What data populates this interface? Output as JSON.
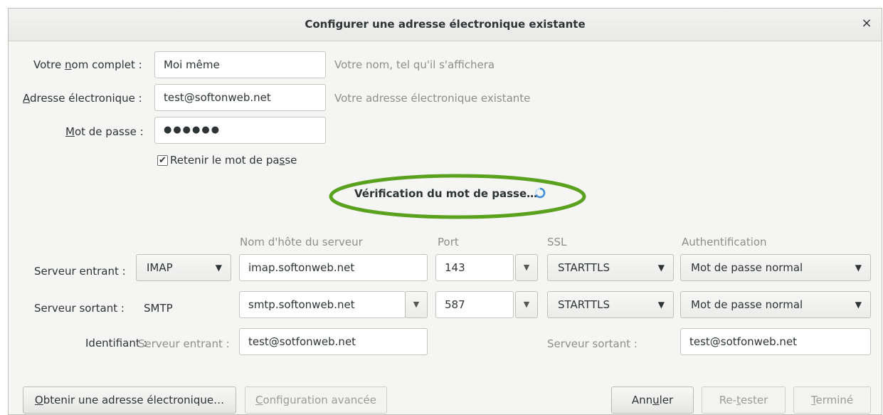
{
  "window": {
    "title": "Configurer une adresse électronique existante",
    "close_glyph": "×"
  },
  "form": {
    "name": {
      "label_pre": "Votre ",
      "label_key": "n",
      "label_post": "om complet :",
      "value": "Moi même",
      "hint": "Votre nom, tel qu'il s'affichera"
    },
    "email": {
      "label_key": "A",
      "label_post": "dresse électronique :",
      "value": "test@softonweb.net",
      "hint": "Votre adresse électronique existante"
    },
    "password": {
      "label_key": "M",
      "label_post": "ot de passe :",
      "value": "●●●●●●"
    },
    "remember": {
      "checked": true,
      "check_glyph": "✔",
      "label_pre": "Retenir le mot de pa",
      "label_key": "s",
      "label_post": "se"
    }
  },
  "status": {
    "text": "Vérification du mot de passe…",
    "icon": "spinner-icon",
    "highlight_color": "#5aa11e"
  },
  "server_table": {
    "headers": {
      "hostname": "Nom d'hôte du serveur",
      "port": "Port",
      "ssl": "SSL",
      "auth": "Authentification"
    },
    "incoming": {
      "label": "Serveur entrant :",
      "protocol": "IMAP",
      "hostname": "imap.softonweb.net",
      "port": "143",
      "ssl": "STARTTLS",
      "auth": "Mot de passe normal"
    },
    "outgoing": {
      "label": "Serveur sortant :",
      "protocol": "SMTP",
      "hostname": "smtp.softonweb.net",
      "port": "587",
      "ssl": "STARTTLS",
      "auth": "Mot de passe normal"
    },
    "identifier": {
      "label": "Identifiant :",
      "incoming_label": "Serveur entrant :",
      "incoming_value": "test@sotfonweb.net",
      "outgoing_label": "Serveur sortant :",
      "outgoing_value": "test@sotfonweb.net"
    }
  },
  "buttons": {
    "get_address": {
      "key": "O",
      "rest": "btenir une adresse électronique…"
    },
    "advanced": {
      "key": "C",
      "rest": "onfiguration avancée"
    },
    "cancel": {
      "pre": "Ann",
      "key": "u",
      "post": "ler"
    },
    "retest": {
      "pre": "Re-",
      "key": "t",
      "post": "ester"
    },
    "done": {
      "key": "T",
      "rest": "erminé"
    }
  },
  "colors": {
    "accent_spinner": "#3d8fd6",
    "ellipse": "#5aa11e"
  }
}
